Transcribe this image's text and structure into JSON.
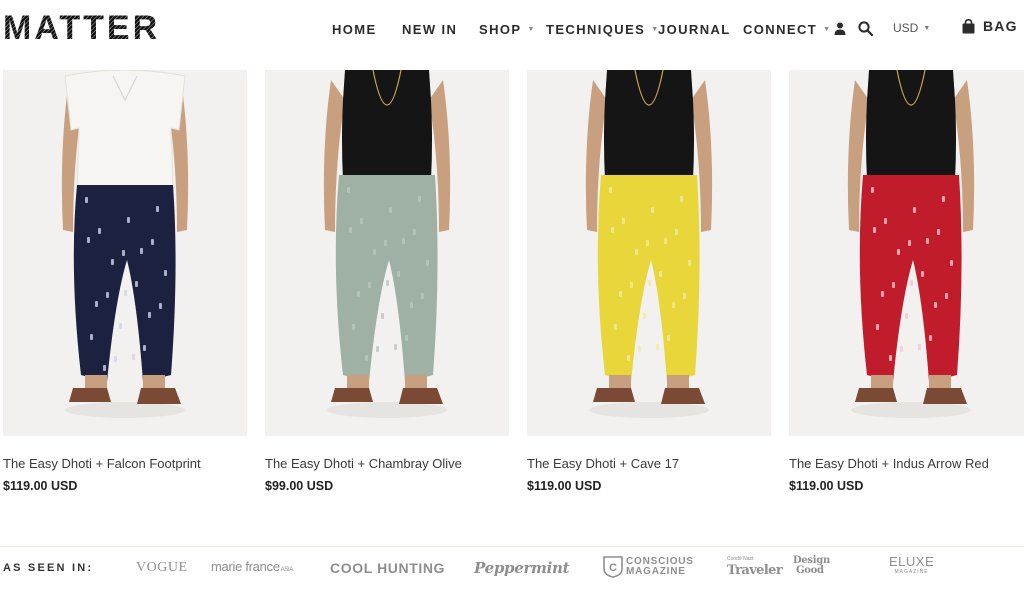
{
  "brand": {
    "name": "MATTER"
  },
  "nav": {
    "items": [
      {
        "label": "HOME",
        "has_dropdown": false
      },
      {
        "label": "NEW IN",
        "has_dropdown": false
      },
      {
        "label": "SHOP",
        "has_dropdown": true
      },
      {
        "label": "TECHNIQUES",
        "has_dropdown": true
      },
      {
        "label": "JOURNAL",
        "has_dropdown": false
      },
      {
        "label": "CONNECT",
        "has_dropdown": true
      }
    ],
    "caret_glyph": "▼",
    "currency": "USD",
    "bag_label": "BAG",
    "icons": [
      "user-icon",
      "search-icon",
      "bag-icon"
    ]
  },
  "products": [
    {
      "name": "The Easy Dhoti + Falcon Footprint",
      "price": "$119.00 USD",
      "top_color": "#f7f5f1",
      "pants_color": "#1c2140",
      "pattern_color": "#cfd3e6"
    },
    {
      "name": "The Easy Dhoti + Chambray Olive",
      "price": "$99.00 USD",
      "top_color": "#151515",
      "pants_color": "#9fb1a4",
      "pattern_color": "#b9c8bd"
    },
    {
      "name": "The Easy Dhoti + Cave 17",
      "price": "$119.00 USD",
      "top_color": "#151515",
      "pants_color": "#e8d63a",
      "pattern_color": "#f3ea9e"
    },
    {
      "name": "The Easy Dhoti + Indus Arrow Red",
      "price": "$119.00 USD",
      "top_color": "#151515",
      "pants_color": "#c01c2c",
      "pattern_color": "#f0c8cc"
    }
  ],
  "press": {
    "label": "AS SEEN IN:",
    "logos": [
      {
        "text": "VOGUE"
      },
      {
        "text": "marie france",
        "suffix": "ASIA"
      },
      {
        "text": "COOL HUNTING"
      },
      {
        "text": "Peppermint"
      },
      {
        "text": "CONSCIOUS",
        "text2": "MAGAZINE",
        "badge": "C"
      },
      {
        "text": "Traveler",
        "small": "Condé Nast"
      },
      {
        "text": "Design",
        "text2": "Good"
      },
      {
        "text": "ELUXE",
        "text2": "MAGAZINE"
      }
    ]
  },
  "colors": {
    "skin": "#c9a07f",
    "sandal": "#7a4a34",
    "photo_bg": "#f2f1ef",
    "accent_line": "#f1e6d6"
  }
}
